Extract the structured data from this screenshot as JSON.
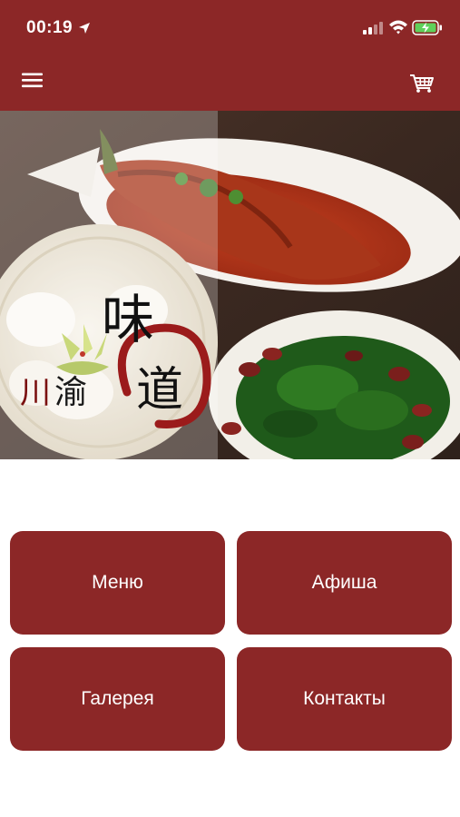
{
  "status_bar": {
    "time": "00:19",
    "icons": [
      "location-arrow-icon",
      "signal-icon",
      "wifi-icon",
      "battery-charging-icon"
    ]
  },
  "nav": {
    "menu_icon": "hamburger-menu-icon",
    "cart_icon": "shopping-cart-icon"
  },
  "hero": {
    "logo_chars": [
      "川",
      "渝",
      "味",
      "道"
    ]
  },
  "tiles": [
    {
      "label": "Меню"
    },
    {
      "label": "Афиша"
    },
    {
      "label": "Галерея"
    },
    {
      "label": "Контакты"
    }
  ],
  "colors": {
    "brand": "#8c2727",
    "text_on_brand": "#ffffff",
    "background": "#ffffff"
  }
}
